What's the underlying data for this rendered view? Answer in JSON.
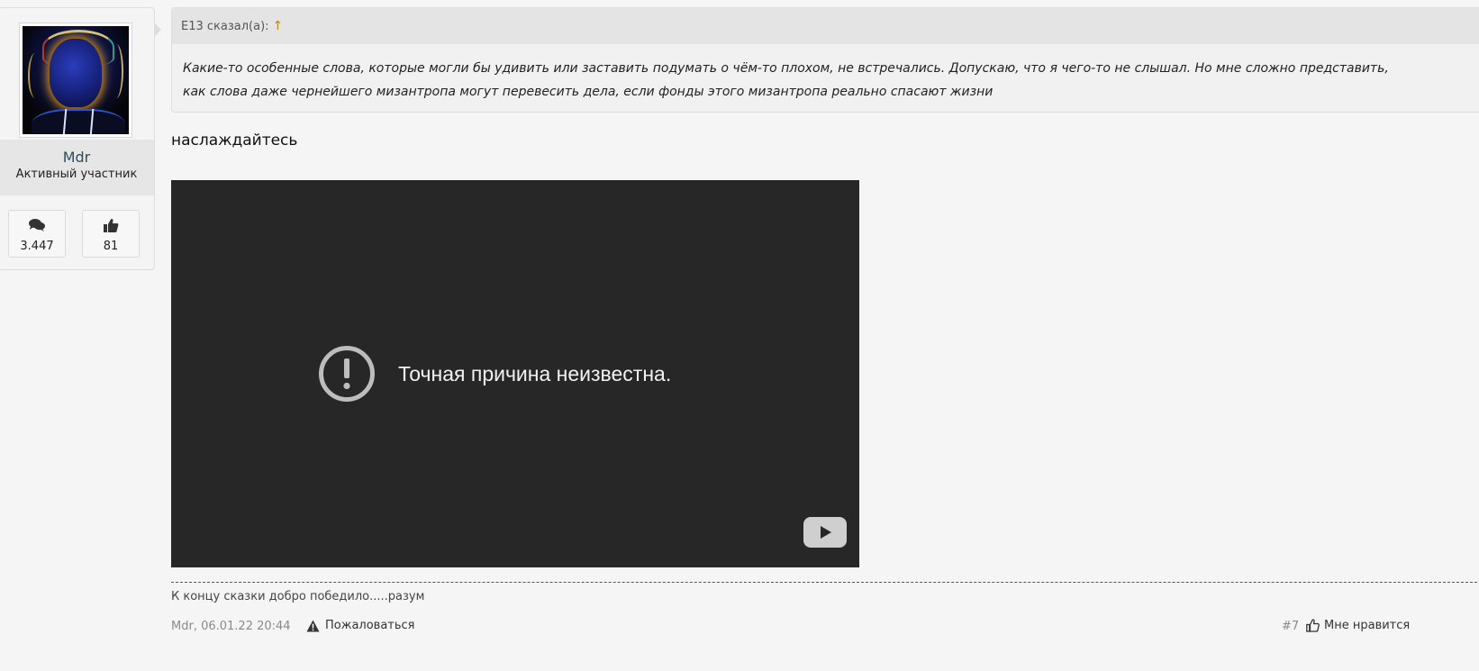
{
  "user": {
    "name": "Mdr",
    "title": "Активный участник",
    "messages_count": "3.447",
    "likes_count": "81",
    "icons": [
      "comments-icon",
      "thumbs-up-icon"
    ]
  },
  "quote": {
    "author": "E13 сказал(а):",
    "arrow": "↑",
    "text": "Какие-то особенные слова, которые могли бы удивить или заставить подумать о чём-то плохом, не встречались. Допускаю, что я чего-то не слышал. Но мне сложно представить, как слова даже чернейшего мизантропа могут перевесить дела, если фонды этого мизантропа реально спасают жизни"
  },
  "post": {
    "text": "наслаждайтесь",
    "video": {
      "error_message": "Точная причина неизвестна.",
      "icons": [
        "alert-circle-icon",
        "youtube-logo-icon"
      ]
    },
    "signature": "К концу сказки добро победило.....разум",
    "meta": "Mdr, 06.01.22 20:44",
    "report_label": "Пожаловаться",
    "number": "#7",
    "like_label": "Мне нравится"
  },
  "colors": {
    "page_bg": "#f5f5f5",
    "video_bg": "#272727",
    "quote_arrow": "#c8870f",
    "username": "#2f4b5c"
  }
}
